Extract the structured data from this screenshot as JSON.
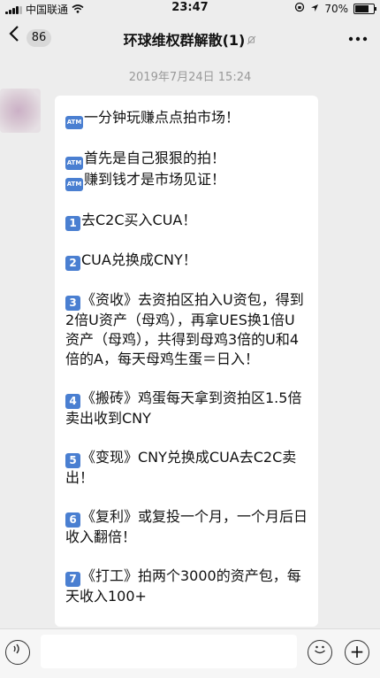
{
  "status_bar": {
    "carrier": "中国联通",
    "wifi_icon": "wifi-icon",
    "time": "23:47",
    "battery": "70%"
  },
  "nav": {
    "back_icon": "chevron-left-icon",
    "unread_count": "86",
    "title": "环球维权群解散(1)",
    "mute_icon": "bell-muted-icon",
    "more_icon": "more-icon"
  },
  "chat": {
    "timestamp": "2019年7月24日 15:24",
    "message": {
      "paragraphs": [
        [
          {
            "emoji": "ATM",
            "text": "一分钟玩赚点点拍市场！"
          }
        ],
        [
          {
            "emoji": "ATM",
            "text": "首先是自己狠狠的拍！"
          },
          {
            "emoji": "ATM",
            "text": "赚到钱才是市场见证！"
          }
        ],
        [
          {
            "emoji": "1",
            "text": "去C2C买入CUA！"
          }
        ],
        [
          {
            "emoji": "2",
            "text": "CUA兑换成CNY！"
          }
        ],
        [
          {
            "emoji": "3",
            "text": "《资收》去资拍区拍入U资包，得到2倍U资产（母鸡），再拿UES换1倍U资产（母鸡），共得到母鸡3倍的U和4倍的A，每天母鸡生蛋＝日入！"
          }
        ],
        [
          {
            "emoji": "4",
            "text": "《搬砖》鸡蛋每天拿到资拍区1.5倍卖出收到CNY"
          }
        ],
        [
          {
            "emoji": "5",
            "text": "《变现》CNY兑换成CUA去C2C卖出！"
          }
        ],
        [
          {
            "emoji": "6",
            "text": "《复利》或复投一个月，一个月后日收入翻倍！"
          }
        ],
        [
          {
            "emoji": "7",
            "text": "《打工》拍两个3000的资产包，每天收入100+"
          }
        ]
      ]
    }
  },
  "input_bar": {
    "voice_icon": "voice-icon",
    "emoji_icon": "emoji-icon",
    "plus_icon": "plus-icon"
  },
  "colors": {
    "background": "#ededed",
    "bubble": "#ffffff",
    "emoji_key": "#4a7fd1"
  }
}
